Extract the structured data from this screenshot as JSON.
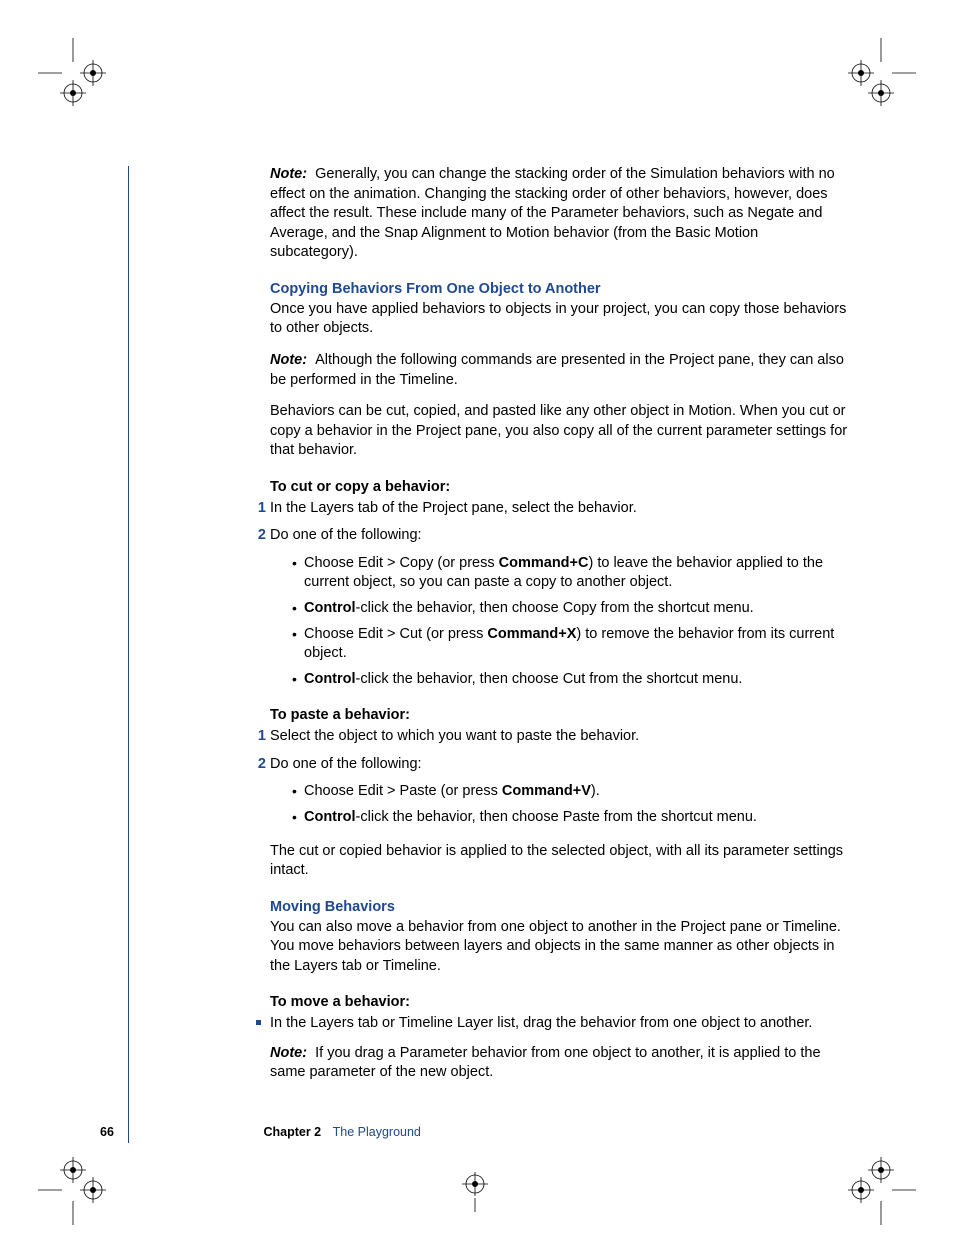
{
  "noteTop": "Generally, you can change the stacking order of the Simulation behaviors with no effect on the animation. Changing the stacking order of other behaviors, however, does affect the result. These include many of the Parameter behaviors, such as Negate and Average, and the Snap Alignment to Motion behavior (from the Basic Motion subcategory).",
  "noteLabel": "Note:",
  "section1": {
    "heading": "Copying Behaviors From One Object to Another",
    "intro": "Once you have applied behaviors to objects in your project, you can copy those behaviors to other objects.",
    "note": "Although the following commands are presented in the Project pane, they can also be performed in the Timeline.",
    "para2": "Behaviors can be cut, copied, and pasted like any other object in Motion. When you cut or copy a behavior in the Project pane, you also copy all of the current parameter settings for that behavior.",
    "task1Heading": "To cut or copy a behavior:",
    "task1Step1": "In the Layers tab of the Project pane, select the behavior.",
    "task1Step2": "Do one of the following:",
    "task1Bullets": {
      "b1a": "Choose Edit > Copy (or press ",
      "b1b": "Command+C",
      "b1c": ") to leave the behavior applied to the current object, so you can paste a copy to another object.",
      "b2a": "Control",
      "b2b": "-click the behavior, then choose Copy from the shortcut menu.",
      "b3a": "Choose Edit > Cut (or press ",
      "b3b": "Command+X",
      "b3c": ") to remove the behavior from its current object.",
      "b4a": "Control",
      "b4b": "-click the behavior, then choose Cut from the shortcut menu."
    },
    "task2Heading": "To paste a behavior:",
    "task2Step1": "Select the object to which you want to paste the behavior.",
    "task2Step2": "Do one of the following:",
    "task2Bullets": {
      "b1a": "Choose Edit > Paste (or press ",
      "b1b": "Command+V",
      "b1c": ").",
      "b2a": "Control",
      "b2b": "-click the behavior, then choose Paste from the shortcut menu."
    },
    "closing": "The cut or copied behavior is applied to the selected object, with all its parameter settings intact."
  },
  "section2": {
    "heading": "Moving Behaviors",
    "intro": "You can also move a behavior from one object to another in the Project pane or Timeline. You move behaviors between layers and objects in the same manner as other objects in the Layers tab or Timeline.",
    "taskHeading": "To move a behavior:",
    "step": "In the Layers tab or Timeline Layer list, drag the behavior from one object to another.",
    "note": "If you drag a Parameter behavior from one object to another, it is applied to the same parameter of the new object."
  },
  "footer": {
    "pageNum": "66",
    "chapterLabel": "Chapter 2",
    "chapterTitle": "The Playground"
  },
  "numbers": {
    "one": "1",
    "two": "2"
  }
}
